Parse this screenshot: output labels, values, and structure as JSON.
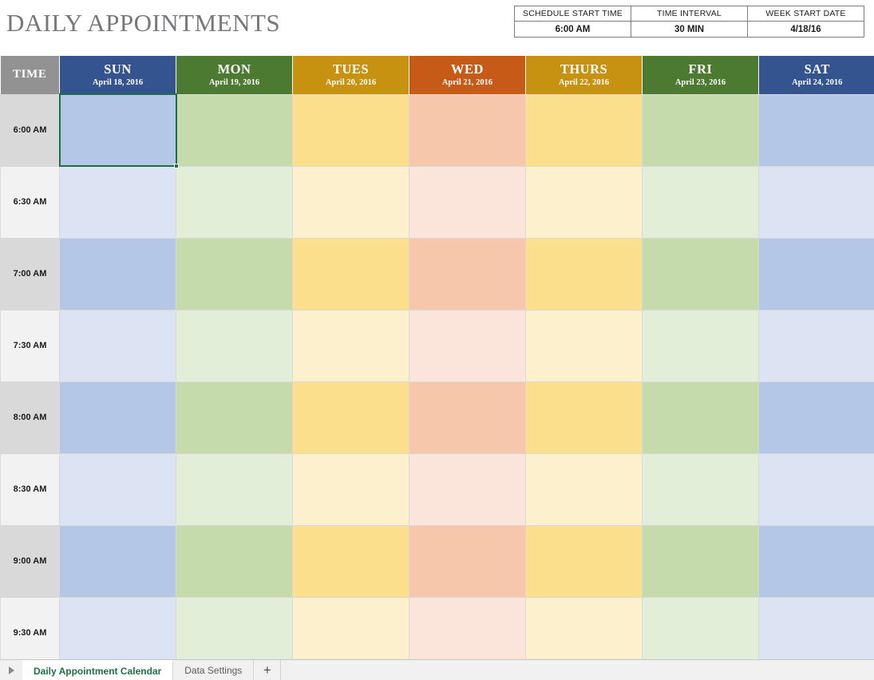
{
  "page": {
    "title": "DAILY APPOINTMENTS"
  },
  "settings": {
    "headers": [
      "SCHEDULE START TIME",
      "TIME INTERVAL",
      "WEEK START DATE"
    ],
    "values": [
      "6:00 AM",
      "30 MIN",
      "4/18/16"
    ]
  },
  "grid": {
    "time_header": "TIME",
    "days": [
      {
        "name": "SUN",
        "date": "April 18, 2016",
        "header_color": "#33548f",
        "fill_dark": "#b4c7e7",
        "fill_light": "#dce3f3"
      },
      {
        "name": "MON",
        "date": "April 19, 2016",
        "header_color": "#4c7a30",
        "fill_dark": "#c6dbac",
        "fill_light": "#e3eed8"
      },
      {
        "name": "TUES",
        "date": "April 20, 2016",
        "header_color": "#c89211",
        "fill_dark": "#fbdf8d",
        "fill_light": "#fdf1cd"
      },
      {
        "name": "WED",
        "date": "April 21, 2016",
        "header_color": "#c85a17",
        "fill_dark": "#f6c7ab",
        "fill_light": "#fbe5da"
      },
      {
        "name": "THURS",
        "date": "April 22, 2016",
        "header_color": "#c89211",
        "fill_dark": "#fbdf8d",
        "fill_light": "#fdf1cd"
      },
      {
        "name": "FRI",
        "date": "April 23, 2016",
        "header_color": "#4c7a30",
        "fill_dark": "#c6dbac",
        "fill_light": "#e3eed8"
      },
      {
        "name": "SAT",
        "date": "April 24, 2016",
        "header_color": "#33548f",
        "fill_dark": "#b4c7e7",
        "fill_light": "#dce3f3"
      }
    ],
    "time_slots": [
      "6:00 AM",
      "6:30 AM",
      "7:00 AM",
      "7:30 AM",
      "8:00 AM",
      "8:30 AM",
      "9:00 AM",
      "9:30 AM"
    ],
    "selected_cell": {
      "row": 0,
      "col": 0
    }
  },
  "tabbar": {
    "nav_arrow": "play-right-icon",
    "tabs": [
      {
        "label": "Daily Appointment Calendar",
        "active": true
      },
      {
        "label": "Data Settings",
        "active": false
      }
    ],
    "add_label": "+"
  },
  "colors": {
    "title_gray": "#77767b",
    "time_header_gray": "#929292",
    "selection_green": "#1d7044",
    "active_tab_text": "#1d7044"
  }
}
